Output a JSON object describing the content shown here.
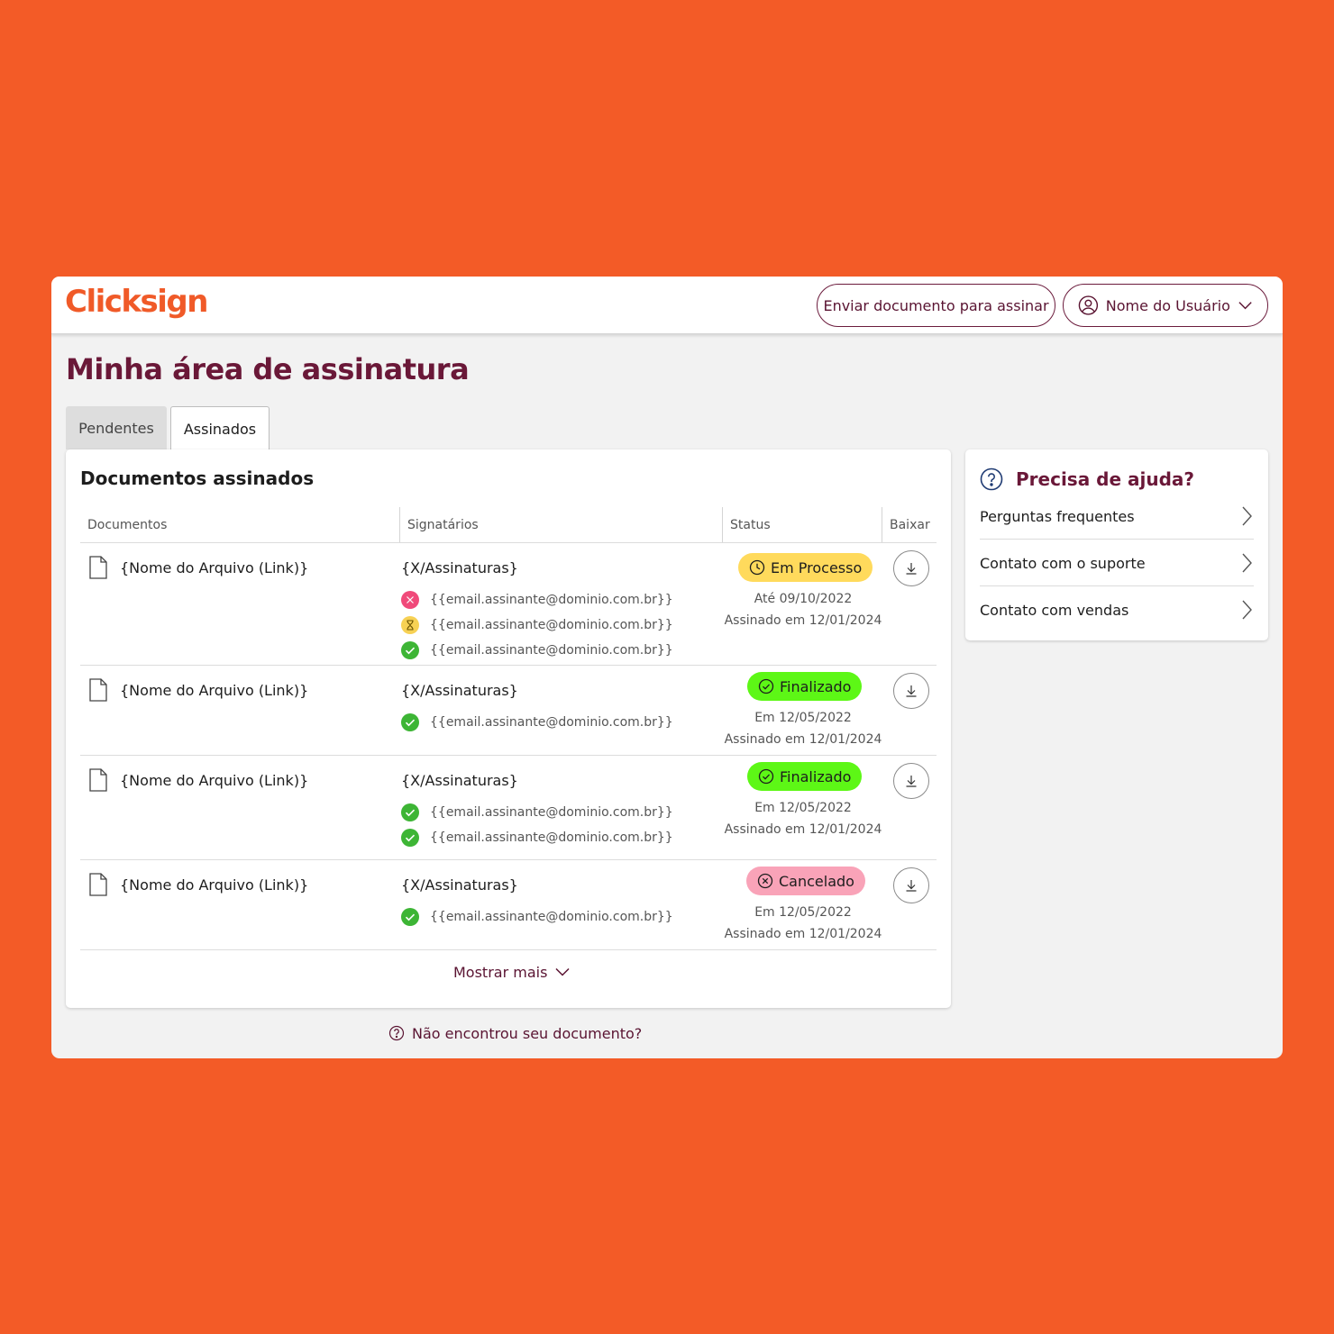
{
  "header": {
    "logo": "Clicksign",
    "send_button": "Enviar documento para assinar",
    "user_name": "Nome do Usuário"
  },
  "page": {
    "title": "Minha área de assinatura",
    "tabs": [
      {
        "label": "Pendentes",
        "active": false
      },
      {
        "label": "Assinados",
        "active": true
      }
    ]
  },
  "documents": {
    "title": "Documentos assinados",
    "columns": [
      "Documentos",
      "Signatários",
      "Status",
      "Baixar"
    ],
    "rows": [
      {
        "file": "{Nome do Arquivo (Link)}",
        "signatures": "{X/Assinaturas}",
        "signers": [
          {
            "state": "rejected",
            "icon": "x-circle-icon",
            "email": "{{email.assinante@dominio.com.br}}"
          },
          {
            "state": "pending",
            "icon": "hourglass-icon",
            "email": "{{email.assinante@dominio.com.br}}"
          },
          {
            "state": "signed",
            "icon": "check-circle-icon",
            "email": "{{email.assinante@dominio.com.br}}"
          }
        ],
        "status": "Em Processo",
        "status_color": "#FFDA5C",
        "date1": "Até 09/10/2022",
        "date2": "Assinado em 12/01/2024"
      },
      {
        "file": "{Nome do Arquivo (Link)}",
        "signatures": "{X/Assinaturas}",
        "signers": [
          {
            "state": "signed",
            "icon": "check-circle-icon",
            "email": "{{email.assinante@dominio.com.br}}"
          }
        ],
        "status": "Finalizado",
        "status_color": "#5DF716",
        "date1": "Em 12/05/2022",
        "date2": "Assinado em 12/01/2024"
      },
      {
        "file": "{Nome do Arquivo (Link)}",
        "signatures": "{X/Assinaturas}",
        "signers": [
          {
            "state": "signed",
            "icon": "check-circle-icon",
            "email": "{{email.assinante@dominio.com.br}}"
          },
          {
            "state": "signed",
            "icon": "check-circle-icon",
            "email": "{{email.assinante@dominio.com.br}}"
          }
        ],
        "status": "Finalizado",
        "status_color": "#5DF716",
        "date1": "Em 12/05/2022",
        "date2": "Assinado em 12/01/2024"
      },
      {
        "file": "{Nome do Arquivo (Link)}",
        "signatures": "{X/Assinaturas}",
        "signers": [
          {
            "state": "signed",
            "icon": "check-circle-icon",
            "email": "{{email.assinante@dominio.com.br}}"
          }
        ],
        "status": "Cancelado",
        "status_color": "#F9A3B8",
        "date1": "Em 12/05/2022",
        "date2": "Assinado em 12/01/2024"
      }
    ],
    "show_more": "Mostrar mais"
  },
  "not_found": "Não encontrou seu documento?",
  "help": {
    "title": "Precisa de ajuda?",
    "items": [
      "Perguntas frequentes",
      "Contato com o suporte",
      "Contato com vendas"
    ]
  },
  "colors": {
    "background": "#F35B27",
    "brand": "#F05A28",
    "primary_text": "#6A1838",
    "signed": "#3DB535",
    "rejected": "#F04A7A",
    "pending": "#F7D154"
  }
}
